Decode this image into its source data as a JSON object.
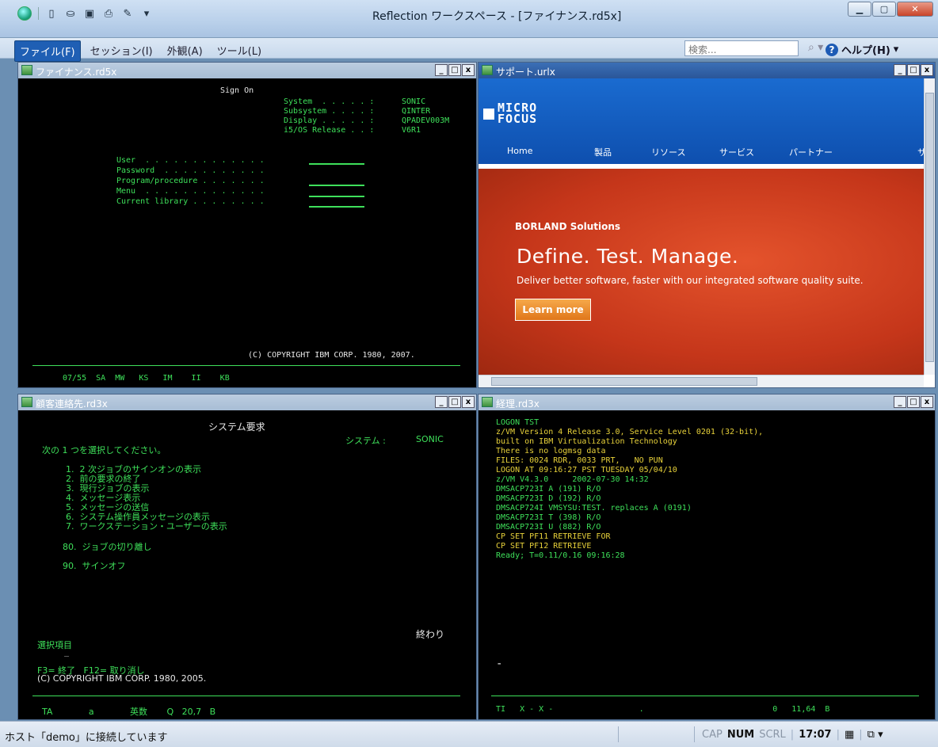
{
  "app": {
    "title": "Reflection ワークスペース - [ファイナンス.rd5x]"
  },
  "menu": {
    "items": [
      "ファイル(F)",
      "セッション(I)",
      "外観(A)",
      "ツール(L)"
    ],
    "search_placeholder": "検索...",
    "help_label": "ヘルプ(H)"
  },
  "windows": {
    "finance": {
      "title": "ファイナンス.rd5x",
      "lines": {
        "signon": "Sign On",
        "system_label": "System  . . . . . :",
        "system_val": "SONIC",
        "subsystem_label": "Subsystem . . . . :",
        "subsystem_val": "QINTER",
        "display_label": "Display . . . . . :",
        "display_val": "QPADEV003M",
        "release_label": "i5/OS Release . . :",
        "release_val": "V6R1",
        "user": "User  . . . . . . . . . . . . .",
        "password": "Password  . . . . . . . . . . .",
        "program": "Program/procedure . . . . . . .",
        "menu": "Menu  . . . . . . . . . . . . .",
        "library": "Current library . . . . . . . .",
        "copyright": "(C) COPYRIGHT IBM CORP. 1980, 2007.",
        "status": "07/55  SA  MW   KS   IM    II    KB"
      }
    },
    "support": {
      "title": "サポート.urlx",
      "logo": "MICRO FOCUS",
      "nav": [
        "Home",
        "製品",
        "リソース",
        "サービス",
        "パートナー",
        "サ"
      ],
      "banner_small": "BORLAND Solutions",
      "banner_big": "Define. Test. Manage.",
      "banner_sub": "Deliver better software, faster with our integrated software quality suite.",
      "cta": "Learn more"
    },
    "customer": {
      "title": "顧客連絡先.rd3x",
      "lines": {
        "heading": "システム要求",
        "system_label": "システム :",
        "system_val": "SONIC",
        "prompt": "次の 1 つを選択してください。",
        "o1": "1.  2 次ジョブのサインオンの表示",
        "o2": "2.  前の要求の終了",
        "o3": "3.  現行ジョブの表示",
        "o4": "4.  メッセージ表示",
        "o5": "5.  メッセージの送信",
        "o6": "6.  システム操作員メッセージの表示",
        "o7": "7.  ワークステーション・ユーザーの表示",
        "o80": "80.  ジョブの切り離し",
        "o90": "90.  サインオフ",
        "end": "終わり",
        "select": "選択項目",
        "cursor": "_",
        "fkeys": "F3= 終了   F12= 取り消し",
        "copyright": "(C) COPYRIGHT IBM CORP. 1980, 2005.",
        "status": "TA             a             英数       Q   20,7   B"
      }
    },
    "accounting": {
      "title": "経理.rd3x",
      "lines": [
        "LOGON TST",
        "z/VM Version 4 Release 3.0, Service Level 0201 (32-bit),",
        "built on IBM Virtualization Technology",
        "There is no logmsg data",
        "FILES: 0024 RDR, 0033 PRT,   NO PUN",
        "LOGON AT 09:16:27 PST TUESDAY 05/04/10",
        "z/VM V4.3.0     2002-07-30 14:32",
        "DMSACP723I A (191) R/O",
        "DMSACP723I D (192) R/O",
        "DMSACP724I VMSYSU:TEST. replaces A (0191)",
        "DMSACP723I T (398) R/O",
        "DMSACP723I U (882) R/O",
        "CP SET PF11 RETRIEVE FOR",
        "CP SET PF12 RETRIEVE",
        "Ready; T=0.11/0.16 09:16:28"
      ],
      "cursor": "-",
      "status": "TI   X - X -                  .                           0   11,64  B"
    }
  },
  "status": {
    "message": "ホスト「demo」に接続しています",
    "cap": "CAP",
    "num": "NUM",
    "scrl": "SCRL",
    "time": "17:07"
  }
}
